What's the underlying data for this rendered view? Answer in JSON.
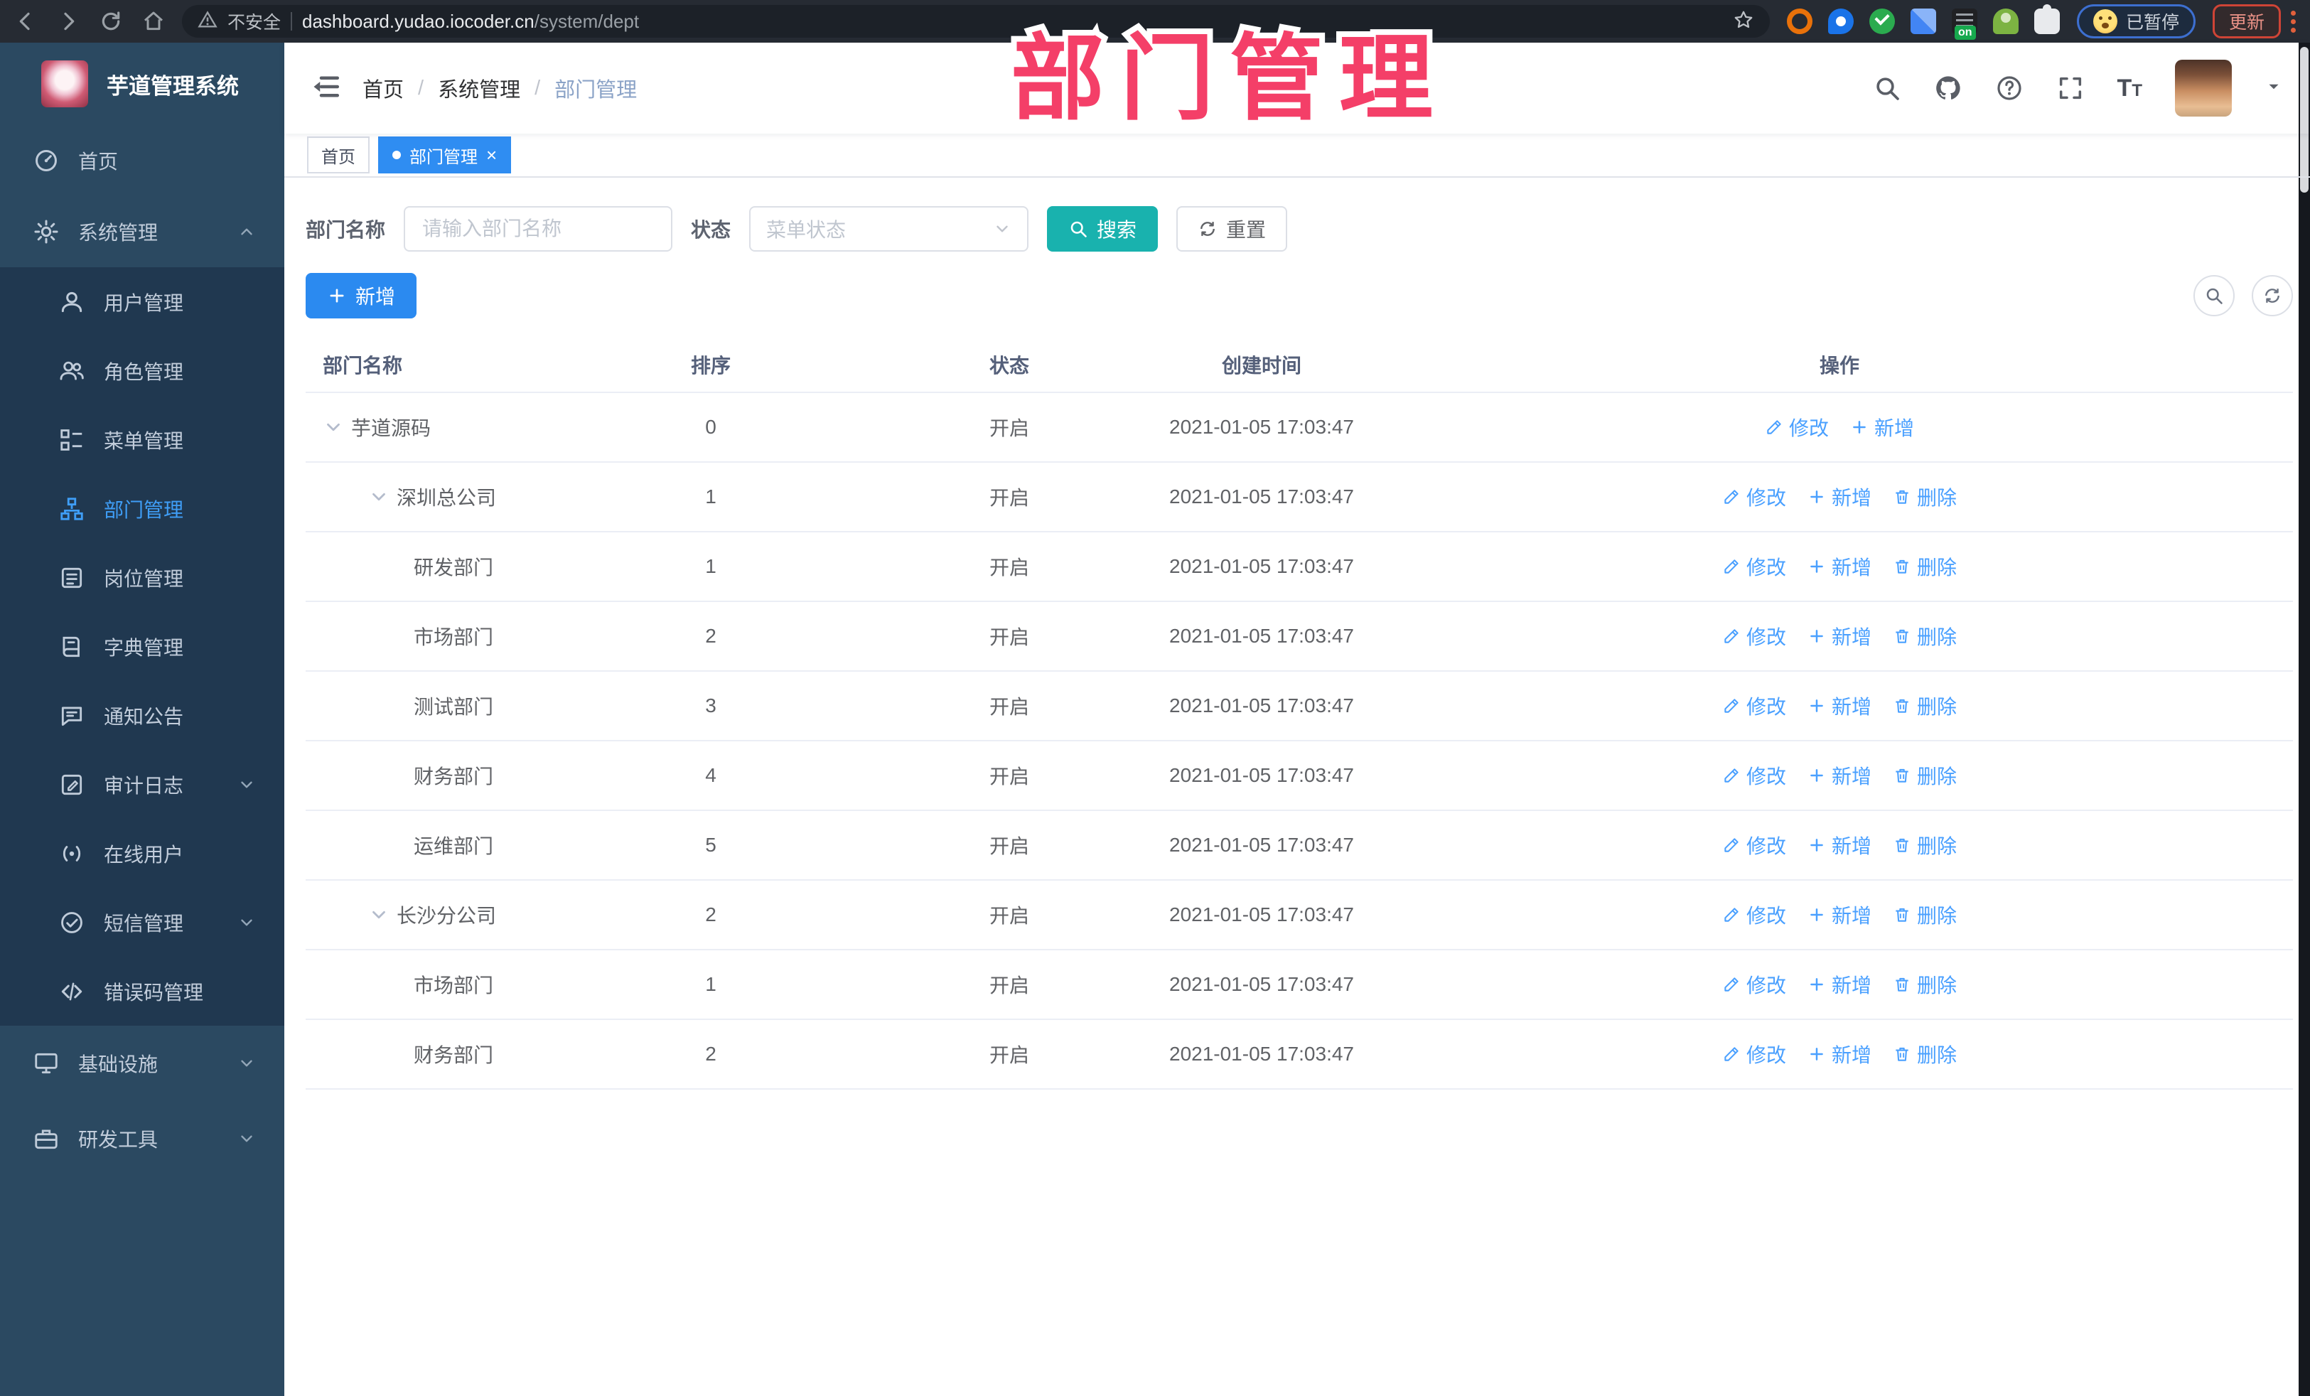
{
  "watermark": "部门管理",
  "browser": {
    "insecure_label": "不安全",
    "url_host": "dashboard.yudao.iocoder.cn",
    "url_path": "/system/dept",
    "paused_label": "已暂停",
    "update_label": "更新"
  },
  "sidebar": {
    "title": "芋道管理系统",
    "items": [
      {
        "label": "首页",
        "icon": "dashboard-icon"
      },
      {
        "label": "系统管理",
        "icon": "gear-icon"
      },
      {
        "label": "用户管理",
        "icon": "user-icon"
      },
      {
        "label": "角色管理",
        "icon": "role-icon"
      },
      {
        "label": "菜单管理",
        "icon": "menu-tree-icon"
      },
      {
        "label": "部门管理",
        "icon": "org-icon"
      },
      {
        "label": "岗位管理",
        "icon": "badge-icon"
      },
      {
        "label": "字典管理",
        "icon": "book-icon"
      },
      {
        "label": "通知公告",
        "icon": "notice-icon"
      },
      {
        "label": "审计日志",
        "icon": "log-icon"
      },
      {
        "label": "在线用户",
        "icon": "online-icon"
      },
      {
        "label": "短信管理",
        "icon": "sms-icon"
      },
      {
        "label": "错误码管理",
        "icon": "code-icon"
      },
      {
        "label": "基础设施",
        "icon": "monitor-icon"
      },
      {
        "label": "研发工具",
        "icon": "toolbox-icon"
      }
    ]
  },
  "breadcrumb": [
    "首页",
    "系统管理",
    "部门管理"
  ],
  "tags": [
    {
      "label": "首页",
      "active": false
    },
    {
      "label": "部门管理",
      "active": true
    }
  ],
  "filters": {
    "dept_label": "部门名称",
    "dept_placeholder": "请输入部门名称",
    "status_label": "状态",
    "status_placeholder": "菜单状态",
    "search_label": "搜索",
    "reset_label": "重置"
  },
  "toolbar": {
    "add_label": "新增"
  },
  "table": {
    "columns": [
      "部门名称",
      "排序",
      "状态",
      "创建时间",
      "操作"
    ],
    "op_labels": {
      "edit": "修改",
      "add": "新增",
      "delete": "删除"
    },
    "rows": [
      {
        "name": "芋道源码",
        "level": 0,
        "expandable": true,
        "order": "0",
        "status": "开启",
        "created": "2021-01-05 17:03:47",
        "ops": [
          "edit",
          "add"
        ]
      },
      {
        "name": "深圳总公司",
        "level": 1,
        "expandable": true,
        "order": "1",
        "status": "开启",
        "created": "2021-01-05 17:03:47",
        "ops": [
          "edit",
          "add",
          "delete"
        ]
      },
      {
        "name": "研发部门",
        "level": 2,
        "expandable": false,
        "order": "1",
        "status": "开启",
        "created": "2021-01-05 17:03:47",
        "ops": [
          "edit",
          "add",
          "delete"
        ]
      },
      {
        "name": "市场部门",
        "level": 2,
        "expandable": false,
        "order": "2",
        "status": "开启",
        "created": "2021-01-05 17:03:47",
        "ops": [
          "edit",
          "add",
          "delete"
        ]
      },
      {
        "name": "测试部门",
        "level": 2,
        "expandable": false,
        "order": "3",
        "status": "开启",
        "created": "2021-01-05 17:03:47",
        "ops": [
          "edit",
          "add",
          "delete"
        ]
      },
      {
        "name": "财务部门",
        "level": 2,
        "expandable": false,
        "order": "4",
        "status": "开启",
        "created": "2021-01-05 17:03:47",
        "ops": [
          "edit",
          "add",
          "delete"
        ]
      },
      {
        "name": "运维部门",
        "level": 2,
        "expandable": false,
        "order": "5",
        "status": "开启",
        "created": "2021-01-05 17:03:47",
        "ops": [
          "edit",
          "add",
          "delete"
        ]
      },
      {
        "name": "长沙分公司",
        "level": 1,
        "expandable": true,
        "order": "2",
        "status": "开启",
        "created": "2021-01-05 17:03:47",
        "ops": [
          "edit",
          "add",
          "delete"
        ]
      },
      {
        "name": "市场部门",
        "level": 2,
        "expandable": false,
        "order": "1",
        "status": "开启",
        "created": "2021-01-05 17:03:47",
        "ops": [
          "edit",
          "add",
          "delete"
        ]
      },
      {
        "name": "财务部门",
        "level": 2,
        "expandable": false,
        "order": "2",
        "status": "开启",
        "created": "2021-01-05 17:03:47",
        "ops": [
          "edit",
          "add",
          "delete"
        ]
      }
    ]
  },
  "colors": {
    "accent": "#2b8af0",
    "search_teal": "#19b2ae",
    "watermark_pink": "#f43f68",
    "sidebar_bg": "#2b4961"
  }
}
